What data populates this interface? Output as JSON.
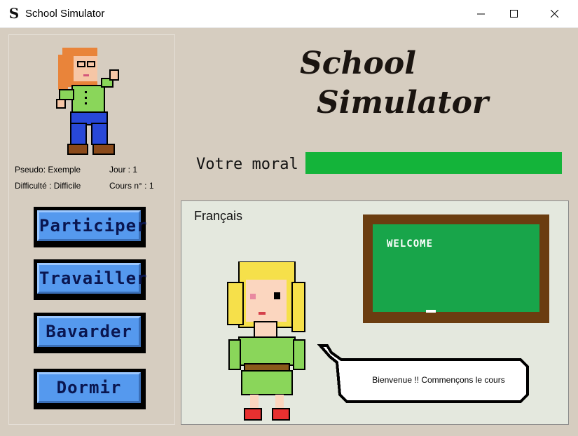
{
  "window": {
    "title": "School Simulator",
    "icon": "S"
  },
  "titlebar_buttons": [
    "minimize-icon",
    "maximize-icon",
    "close-icon"
  ],
  "player": {
    "pseudo": "Pseudo: Exemple",
    "jour": "Jour : 1",
    "difficulte": "Difficulté : Difficile",
    "cours": "Cours n° : 1"
  },
  "actions": [
    "Participer",
    "Travailler",
    "Bavarder",
    "Dormir"
  ],
  "header": {
    "title_line1": "School",
    "title_line2": "Simulator"
  },
  "moral": {
    "label": "Votre moral :",
    "level": 1.0,
    "color": "#14b43a"
  },
  "classroom": {
    "subject": "Français",
    "board_text": "WELCOME",
    "speech": "Bienvenue !! Commençons le cours"
  }
}
